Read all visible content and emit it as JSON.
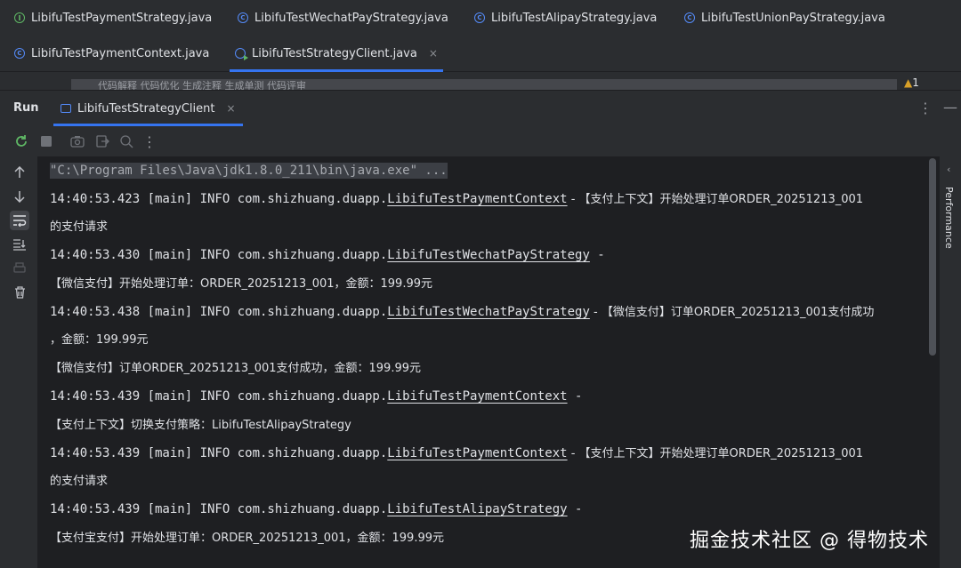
{
  "editor_tabs_row1": [
    {
      "label": "LibifuTestPaymentStrategy.java",
      "icon": "interface-icon"
    },
    {
      "label": "LibifuTestWechatPayStrategy.java",
      "icon": "class-icon"
    },
    {
      "label": "LibifuTestAlipayStrategy.java",
      "icon": "class-icon"
    },
    {
      "label": "LibifuTestUnionPayStrategy.java",
      "icon": "class-icon"
    }
  ],
  "editor_tabs_row2": [
    {
      "label": "LibifuTestPaymentContext.java",
      "icon": "class-icon"
    },
    {
      "label": "LibifuTestStrategyClient.java",
      "icon": "runnable-class-icon",
      "close": "×"
    }
  ],
  "strip": {
    "text": "代码解释   代码优化   生成注释   生成单测   代码评审",
    "warning_count": "1"
  },
  "run_panel": {
    "title": "Run",
    "tab_label": "LibifuTestStrategyClient",
    "tab_close": "×",
    "more": "⋮",
    "minimize": "—"
  },
  "side_panel": {
    "label": "Performance"
  },
  "console": {
    "command": "\"C:\\Program Files\\Java\\jdk1.8.0_211\\bin\\java.exe\" ...",
    "l1_prefix": "14:40:53.423 [main] INFO com.shizhuang.duapp.",
    "l1_class": "LibifuTestPaymentContext",
    "l1_msg": " - 【支付上下文】开始处理订单ORDER_20251213_001",
    "l1_wrap": " 的支付请求",
    "l2_prefix": "14:40:53.430 [main] INFO com.shizhuang.duapp.",
    "l2_class": "LibifuTestWechatPayStrategy",
    "l2_msg": " -",
    "l2_wrap": " 【微信支付】开始处理订单：ORDER_20251213_001，金额：199.99元",
    "l3_prefix": "14:40:53.438 [main] INFO com.shizhuang.duapp.",
    "l3_class": "LibifuTestWechatPayStrategy",
    "l3_msg": " - 【微信支付】订单ORDER_20251213_001支付成功",
    "l3_wrap": " ，金额：199.99元",
    "l4": "【微信支付】订单ORDER_20251213_001支付成功，金额：199.99元",
    "l5_prefix": "14:40:53.439 [main] INFO com.shizhuang.duapp.",
    "l5_class": "LibifuTestPaymentContext",
    "l5_msg": " -",
    "l5_wrap": " 【支付上下文】切换支付策略：LibifuTestAlipayStrategy",
    "l6_prefix": "14:40:53.439 [main] INFO com.shizhuang.duapp.",
    "l6_class": "LibifuTestPaymentContext",
    "l6_msg": " - 【支付上下文】开始处理订单ORDER_20251213_001",
    "l6_wrap": " 的支付请求",
    "l7_prefix": "14:40:53.439 [main] INFO com.shizhuang.duapp.",
    "l7_class": "LibifuTestAlipayStrategy",
    "l7_msg": " -",
    "l7_wrap": " 【支付宝支付】开始处理订单：ORDER_20251213_001，金额：199.99元"
  },
  "watermark": "掘金技术社区 @ 得物技术",
  "colors": {
    "accent": "#3574f0",
    "background": "#1e1f22",
    "panel": "#2b2d30",
    "text": "#dfe1e5"
  }
}
